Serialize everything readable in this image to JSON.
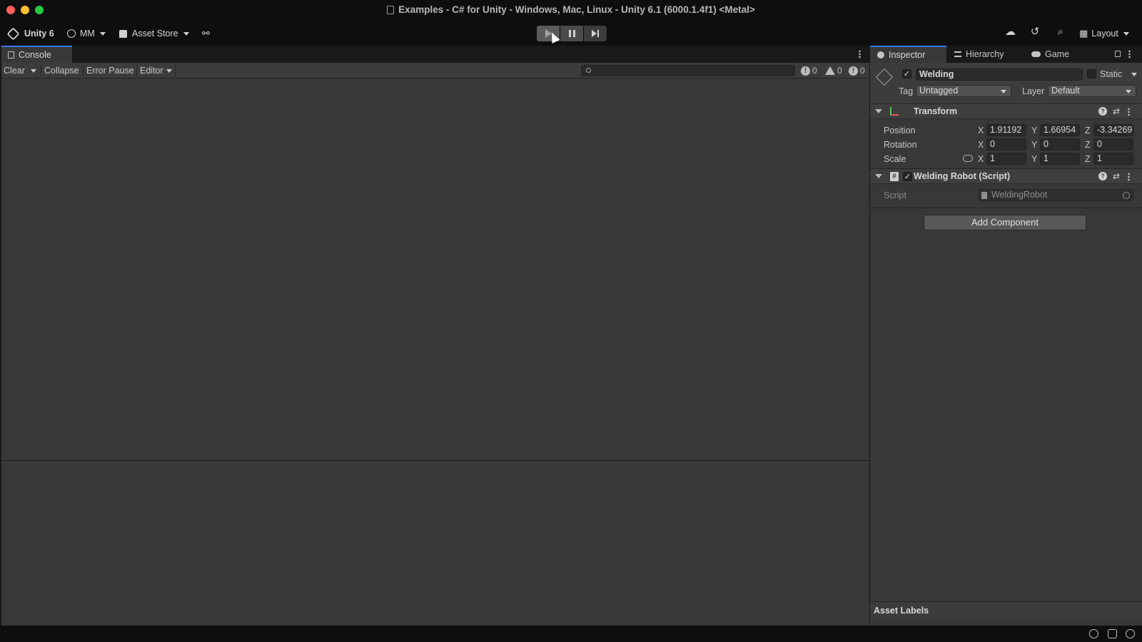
{
  "window": {
    "title": "Examples - C# for Unity - Windows, Mac, Linux - Unity 6.1 (6000.1.4f1) <Metal>"
  },
  "toolbar": {
    "unity_label": "Unity 6",
    "account_label": "MM",
    "asset_store_label": "Asset Store",
    "layout_label": "Layout"
  },
  "console": {
    "tab_label": "Console",
    "clear_label": "Clear",
    "collapse_label": "Collapse",
    "error_pause_label": "Error Pause",
    "editor_label": "Editor",
    "search_placeholder": "",
    "log_count": "0",
    "warning_count": "0",
    "error_count": "0"
  },
  "inspector": {
    "tabs": [
      {
        "label": "Inspector"
      },
      {
        "label": "Hierarchy"
      },
      {
        "label": "Game"
      }
    ],
    "gameobject": {
      "name": "Welding",
      "static_label": "Static",
      "tag_label": "Tag",
      "tag_value": "Untagged",
      "layer_label": "Layer",
      "layer_value": "Default"
    },
    "transform": {
      "title": "Transform",
      "position_label": "Position",
      "rotation_label": "Rotation",
      "scale_label": "Scale",
      "axis_x": "X",
      "axis_y": "Y",
      "axis_z": "Z",
      "position": {
        "x": "1.91192",
        "y": "1.66954",
        "z": "-3.34269"
      },
      "rotation": {
        "x": "0",
        "y": "0",
        "z": "0"
      },
      "scale": {
        "x": "1",
        "y": "1",
        "z": "1"
      }
    },
    "script_component": {
      "title": "Welding Robot (Script)",
      "script_label": "Script",
      "script_value": "WeldingRobot",
      "hash_glyph": "#"
    },
    "add_component_label": "Add Component",
    "asset_labels_label": "Asset Labels"
  },
  "glyphs": {
    "check": "✓",
    "help": "?",
    "preset": "⇄",
    "cloud": "☁",
    "history": "↺",
    "search": "⌕",
    "layout": "▦",
    "package": "⚯",
    "info": "!"
  },
  "colors": {
    "accent_tab": "#3a78ff",
    "panel_bg": "#383838",
    "chrome_bg": "#0e0e0e",
    "axis_x": "#e35959",
    "axis_y": "#5ec25e"
  }
}
